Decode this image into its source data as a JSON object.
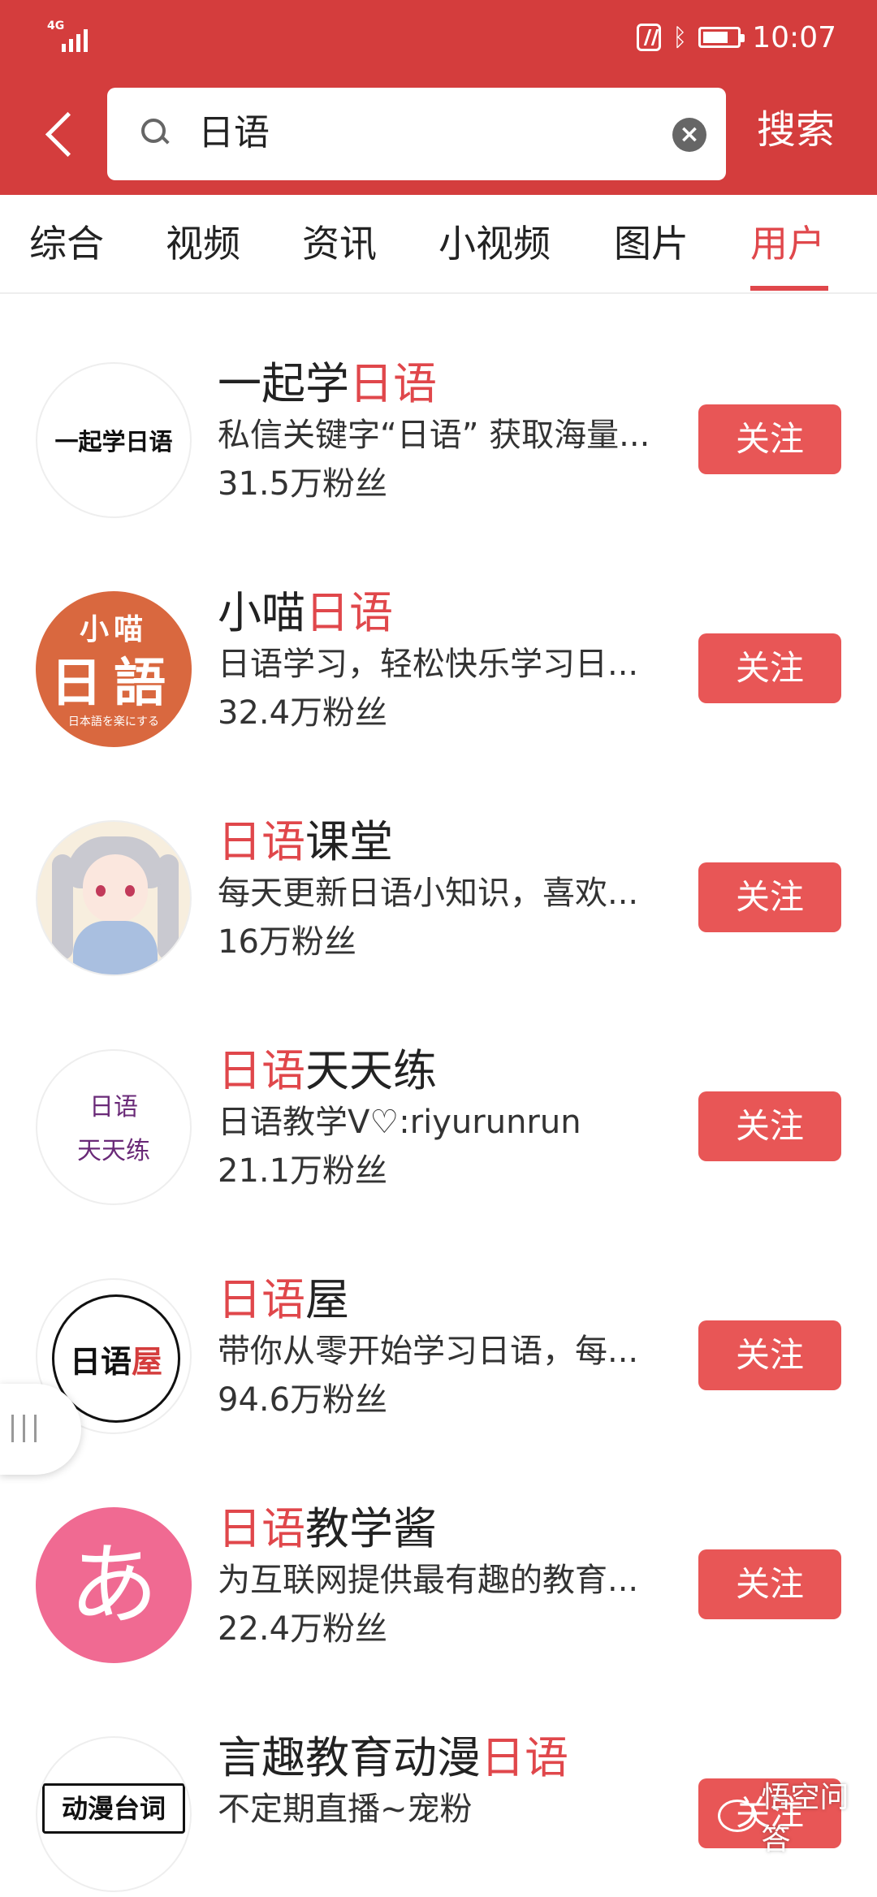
{
  "status_bar": {
    "network": "4G",
    "time": "10:07"
  },
  "search": {
    "query": "日语",
    "button": "搜索"
  },
  "tabs": [
    {
      "label": "综合"
    },
    {
      "label": "视频"
    },
    {
      "label": "资讯"
    },
    {
      "label": "小视频"
    },
    {
      "label": "图片"
    },
    {
      "label": "用户",
      "active": true
    }
  ],
  "users": [
    {
      "name_pre": "一起学",
      "name_hl": "日语",
      "name_post": "",
      "desc": "私信关键字“日语” 获取海量...",
      "fans": "31.5万粉丝",
      "follow": "关注",
      "avatar_text": "一起学日语"
    },
    {
      "name_pre": "小喵",
      "name_hl": "日语",
      "name_post": "",
      "desc": "日语学习，轻松快乐学习日...",
      "fans": "32.4万粉丝",
      "follow": "关注",
      "avatar_t1": "小喵",
      "avatar_t2": "日語",
      "avatar_t3": "日本語を楽にする"
    },
    {
      "name_pre": "",
      "name_hl": "日语",
      "name_post": "课堂",
      "desc": "每天更新日语小知识，喜欢...",
      "fans": "16万粉丝",
      "follow": "关注"
    },
    {
      "name_pre": "",
      "name_hl": "日语",
      "name_post": "天天练",
      "desc": "日语教学V♡:riyurunrun",
      "fans": "21.1万粉丝",
      "follow": "关注",
      "avatar_l1": "日语",
      "avatar_l2": "天天练"
    },
    {
      "name_pre": "",
      "name_hl": "日语",
      "name_post": "屋",
      "desc": "带你从零开始学习日语，每...",
      "fans": "94.6万粉丝",
      "follow": "关注",
      "avatar_a": "日语",
      "avatar_b": "屋"
    },
    {
      "name_pre": "",
      "name_hl": "日语",
      "name_post": "教学酱",
      "desc": "为互联网提供最有趣的教育...",
      "fans": "22.4万粉丝",
      "follow": "关注",
      "avatar_text": "あ"
    },
    {
      "name_pre": "言趣教育动漫",
      "name_hl": "日语",
      "name_post": "",
      "desc": "不定期直播~宠粉",
      "fans": "",
      "follow": "关注",
      "avatar_text": "动漫台词"
    }
  ],
  "watermark": "悟空问答",
  "icons": {
    "back": "chevron-left-icon",
    "search": "search-icon",
    "clear": "clear-icon"
  }
}
